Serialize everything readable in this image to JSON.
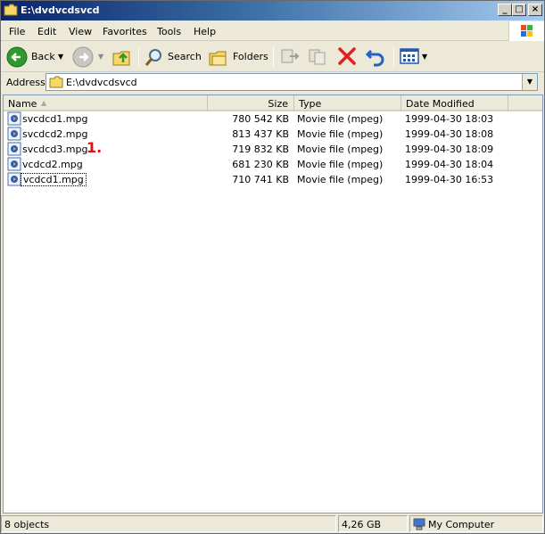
{
  "window": {
    "title": "E:\\dvdvcdsvcd"
  },
  "menu": [
    {
      "label": "File"
    },
    {
      "label": "Edit"
    },
    {
      "label": "View"
    },
    {
      "label": "Favorites"
    },
    {
      "label": "Tools"
    },
    {
      "label": "Help"
    }
  ],
  "toolbar": {
    "back": "Back",
    "search": "Search",
    "folders": "Folders"
  },
  "address": {
    "label": "Address",
    "value": "E:\\dvdvcdsvcd"
  },
  "columns": {
    "name": "Name",
    "size": "Size",
    "type": "Type",
    "date": "Date Modified"
  },
  "files": [
    {
      "name": "svcdcd1.mpg",
      "size": "780 542 KB",
      "type": "Movie file (mpeg)",
      "date": "1999-04-30 18:03"
    },
    {
      "name": "svcdcd2.mpg",
      "size": "813 437 KB",
      "type": "Movie file (mpeg)",
      "date": "1999-04-30 18:08"
    },
    {
      "name": "svcdcd3.mpg",
      "size": "719 832 KB",
      "type": "Movie file (mpeg)",
      "date": "1999-04-30 18:09"
    },
    {
      "name": "vcdcd2.mpg",
      "size": "681 230 KB",
      "type": "Movie file (mpeg)",
      "date": "1999-04-30 18:04"
    },
    {
      "name": "vcdcd1.mpg",
      "size": "710 741 KB",
      "type": "Movie file (mpeg)",
      "date": "1999-04-30 16:53"
    }
  ],
  "annotation": "1.",
  "status": {
    "objects": "8 objects",
    "size": "4,26 GB",
    "location": "My Computer"
  },
  "colors": {
    "annotation": "#e01010",
    "delete": "#e02020",
    "back": "#2e9a2e"
  }
}
